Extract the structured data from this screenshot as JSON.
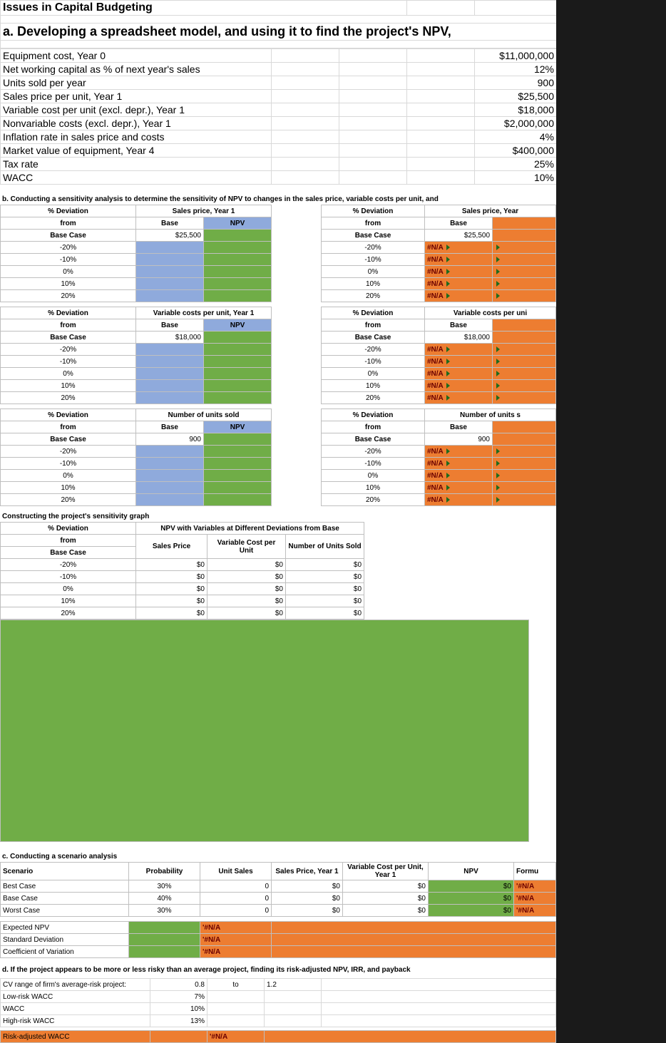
{
  "main_title": "Issues in Capital Budgeting",
  "section_a": "a.  Developing a spreadsheet model, and using it to find the project's NPV,",
  "inputs": [
    {
      "label": "Equipment cost, Year 0",
      "value": "$11,000,000"
    },
    {
      "label": "Net working capital as % of next year's sales",
      "value": "12%"
    },
    {
      "label": "Units sold per year",
      "value": "900"
    },
    {
      "label": "Sales price per unit, Year 1",
      "value": "$25,500"
    },
    {
      "label": "Variable cost per unit (excl. depr.), Year 1",
      "value": "$18,000"
    },
    {
      "label": "Nonvariable costs (excl. depr.), Year 1",
      "value": "$2,000,000"
    },
    {
      "label": "Inflation rate in sales price and costs",
      "value": "4%"
    },
    {
      "label": "Market value of equipment, Year 4",
      "value": "$400,000"
    },
    {
      "label": "Tax rate",
      "value": "25%"
    },
    {
      "label": "WACC",
      "value": "10%"
    }
  ],
  "section_b": "b.  Conducting a sensitivity analysis to determine the sensitivity of NPV to changes in the sales price, variable costs per unit, and",
  "dev_label": "% Deviation",
  "from_label": "from",
  "base_label": "Base Case",
  "base_col": "Base",
  "npv_col": "NPV",
  "sens_tables": [
    {
      "title": "Sales price, Year 1",
      "base": "$25,500",
      "right_title": "Sales price, Year"
    },
    {
      "title": "Variable costs per unit, Year 1",
      "base": "$18,000",
      "right_title": "Variable costs per uni"
    },
    {
      "title": "Number of units sold",
      "base": "900",
      "right_title": "Number of units s"
    }
  ],
  "devs": [
    "-20%",
    "-10%",
    "0%",
    "10%",
    "20%"
  ],
  "na": "#N/A",
  "graph_title": "Constructing the project's sensitivity graph",
  "graph_header": "NPV with Variables at Different Deviations from Base",
  "graph_cols": [
    "Sales Price",
    "Variable Cost per Unit",
    "Number of Units Sold"
  ],
  "zero": "$0",
  "section_c": "c.  Conducting a scenario analysis",
  "scen_cols": [
    "Scenario",
    "Probability",
    "Unit Sales",
    "Sales Price, Year 1",
    "Variable Cost per Unit, Year 1",
    "NPV",
    "Formu"
  ],
  "scenarios": [
    {
      "name": "Best Case",
      "prob": "30%"
    },
    {
      "name": "Base Case",
      "prob": "40%"
    },
    {
      "name": "Worst Case",
      "prob": "30%"
    }
  ],
  "stats": [
    "Expected NPV",
    "Standard Deviation",
    "Coefficient of Variation"
  ],
  "na2": "'#N/A",
  "section_d": "d.  If the project appears to be more or less risky than an average project, finding its risk-adjusted NPV, IRR, and payback",
  "risk_rows": [
    {
      "label": "CV range of firm's average-risk project:",
      "v1": "0.8",
      "v2": "to",
      "v3": "1.2"
    },
    {
      "label": "Low-risk WACC",
      "v1": "7%",
      "v2": "",
      "v3": ""
    },
    {
      "label": "WACC",
      "v1": "10%",
      "v2": "",
      "v3": ""
    },
    {
      "label": "High-risk WACC",
      "v1": "13%",
      "v2": "",
      "v3": ""
    }
  ],
  "risk_adj": "Risk-adjusted WACC"
}
